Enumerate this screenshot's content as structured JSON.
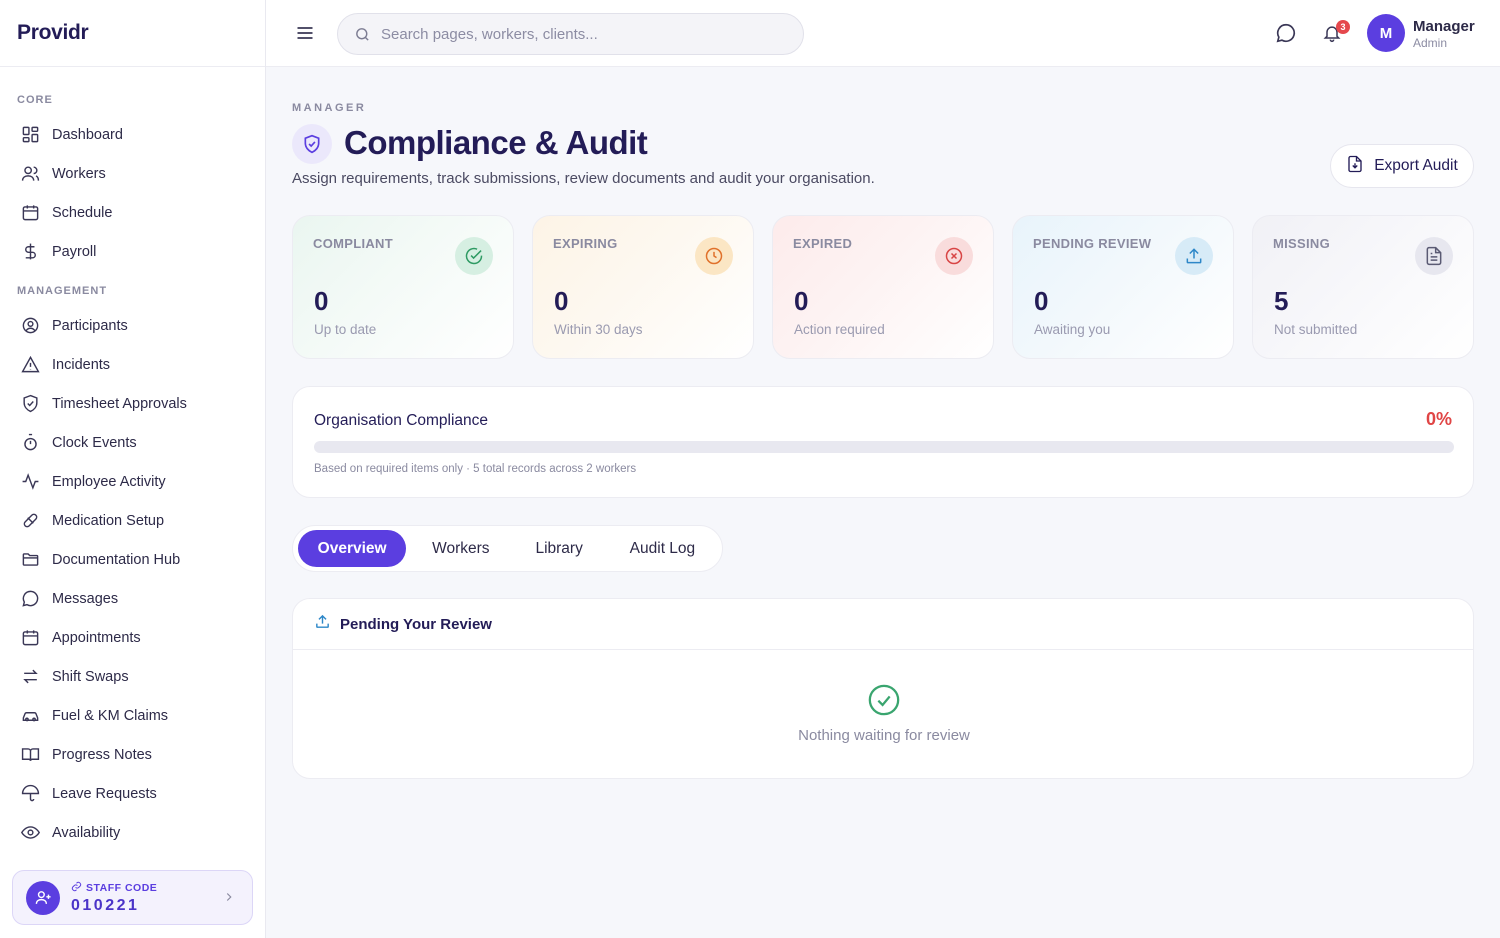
{
  "brand": {
    "name": "Providr"
  },
  "sidebar": {
    "sections": {
      "core": "CORE",
      "management": "MANAGEMENT"
    },
    "core_items": [
      {
        "label": "Dashboard",
        "icon": "dashboard-icon"
      },
      {
        "label": "Workers",
        "icon": "users-icon"
      },
      {
        "label": "Schedule",
        "icon": "calendar-icon"
      },
      {
        "label": "Payroll",
        "icon": "dollar-icon"
      }
    ],
    "management_items": [
      {
        "label": "Participants",
        "icon": "user-circle-icon"
      },
      {
        "label": "Incidents",
        "icon": "warning-icon"
      },
      {
        "label": "Timesheet Approvals",
        "icon": "shield-check-icon"
      },
      {
        "label": "Clock Events",
        "icon": "stopwatch-icon"
      },
      {
        "label": "Employee Activity",
        "icon": "activity-icon"
      },
      {
        "label": "Medication Setup",
        "icon": "pill-icon"
      },
      {
        "label": "Documentation Hub",
        "icon": "folder-icon"
      },
      {
        "label": "Messages",
        "icon": "message-icon"
      },
      {
        "label": "Appointments",
        "icon": "calendar-icon"
      },
      {
        "label": "Shift Swaps",
        "icon": "swap-icon"
      },
      {
        "label": "Fuel & KM Claims",
        "icon": "car-icon"
      },
      {
        "label": "Progress Notes",
        "icon": "book-icon"
      },
      {
        "label": "Leave Requests",
        "icon": "umbrella-icon"
      },
      {
        "label": "Availability",
        "icon": "eye-icon"
      }
    ],
    "staff": {
      "label": "STAFF CODE",
      "code": "010221"
    }
  },
  "topbar": {
    "search_placeholder": "Search pages, workers, clients...",
    "notification_count": "3",
    "user": {
      "initial": "M",
      "name": "Manager",
      "role": "Admin"
    }
  },
  "page": {
    "eyebrow": "MANAGER",
    "title": "Compliance & Audit",
    "subtitle": "Assign requirements, track submissions, review documents and audit your organisation.",
    "export_label": "Export Audit"
  },
  "stats": [
    {
      "label": "COMPLIANT",
      "value": "0",
      "sub": "Up to date",
      "icon": "check-circle-icon",
      "color": "#2e9a63"
    },
    {
      "label": "EXPIRING",
      "value": "0",
      "sub": "Within 30 days",
      "icon": "clock-icon",
      "color": "#e0712b"
    },
    {
      "label": "EXPIRED",
      "value": "0",
      "sub": "Action required",
      "icon": "x-circle-icon",
      "color": "#d84545"
    },
    {
      "label": "PENDING REVIEW",
      "value": "0",
      "sub": "Awaiting you",
      "icon": "upload-icon",
      "color": "#2d87c8"
    },
    {
      "label": "MISSING",
      "value": "5",
      "sub": "Not submitted",
      "icon": "document-icon",
      "color": "#5a5a73"
    }
  ],
  "org_compliance": {
    "title": "Organisation Compliance",
    "percent_label": "0%",
    "percent": 0,
    "note": "Based on required items only · 5 total records across 2 workers"
  },
  "tabs": [
    {
      "label": "Overview",
      "active": true
    },
    {
      "label": "Workers",
      "active": false
    },
    {
      "label": "Library",
      "active": false
    },
    {
      "label": "Audit Log",
      "active": false
    }
  ],
  "review": {
    "title": "Pending Your Review",
    "empty_text": "Nothing waiting for review"
  },
  "colors": {
    "accent": "#5b3ee0",
    "danger": "#e04545",
    "success": "#3aa56f"
  }
}
